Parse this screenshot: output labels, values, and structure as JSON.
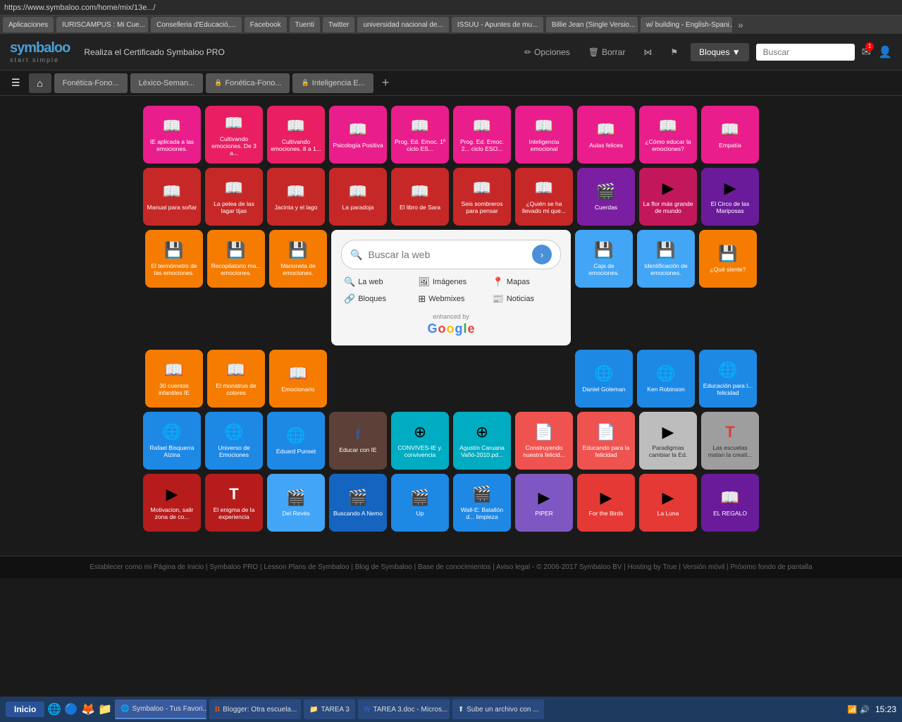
{
  "browser": {
    "url": "https://www.symbaloo.com/home/mix/13e.../",
    "tabs": [
      {
        "label": "Aplicaciones",
        "active": false
      },
      {
        "label": "IURISCAMPUS : Mi Cue...",
        "active": false
      },
      {
        "label": "Conselleria d'Educació,...",
        "active": false
      },
      {
        "label": "Facebook",
        "active": false
      },
      {
        "label": "Tuenti",
        "active": false
      },
      {
        "label": "Twitter",
        "active": false
      },
      {
        "label": "universidad nacional de...",
        "active": false
      },
      {
        "label": "ISSUU - Apuntes de mu...",
        "active": false
      },
      {
        "label": "Billie Jean (Single Versio...",
        "active": false
      },
      {
        "label": "w/ building - English-Spani...",
        "active": false
      }
    ]
  },
  "header": {
    "logo": "symbaloo",
    "logo_sub": "start simple",
    "pro_text": "Realiza el Certificado Symbaloo PRO",
    "options_label": "Opciones",
    "delete_label": "Borrar",
    "blocks_label": "Bloques ▼",
    "search_placeholder": "Buscar"
  },
  "tabs": [
    {
      "label": "Fonética-Fono...",
      "locked": false
    },
    {
      "label": "Léxico-Seman...",
      "locked": false
    },
    {
      "label": "Fonética-Fono...",
      "locked": true
    },
    {
      "label": "Inteligencia E...",
      "locked": true
    }
  ],
  "search": {
    "placeholder": "Buscar la web",
    "links": [
      {
        "icon": "🔍",
        "label": "La web"
      },
      {
        "icon": "🖼",
        "label": "Imágenes"
      },
      {
        "icon": "📍",
        "label": "Mapas"
      },
      {
        "icon": "🔗",
        "label": "Bloques"
      },
      {
        "icon": "⊞",
        "label": "Webmixes"
      },
      {
        "icon": "📰",
        "label": "Noticias"
      }
    ],
    "powered_by": "enhanced by",
    "google": "Google"
  },
  "tiles_row1": [
    {
      "label": "IE aplicada a las emociones.",
      "bg": "#e91e8c",
      "icon": "📖"
    },
    {
      "label": "Cultivando emociones. De 3 a...",
      "bg": "#e91e63",
      "icon": "📖"
    },
    {
      "label": "Cultivando emociones. 8 a 1...",
      "bg": "#e91e63",
      "icon": "📖"
    },
    {
      "label": "Psicología Positiva",
      "bg": "#e91e8c",
      "icon": "📖"
    },
    {
      "label": "Prog. Ed. Emoc. 1º ciclo ES...",
      "bg": "#e91e8c",
      "icon": "📖"
    },
    {
      "label": "Prog. Ed. Emoc. 2... ciclo ESO...",
      "bg": "#e91e8c",
      "icon": "📖"
    },
    {
      "label": "Inteligencia emocional",
      "bg": "#e91e8c",
      "icon": "📖"
    },
    {
      "label": "Aulas felices",
      "bg": "#e91e8c",
      "icon": "📖"
    },
    {
      "label": "¿Cómo educar la emociones?",
      "bg": "#e91e8c",
      "icon": "📖"
    },
    {
      "label": "Empatía",
      "bg": "#e91e8c",
      "icon": "📖"
    }
  ],
  "tiles_row2": [
    {
      "label": "Manual para soñar",
      "bg": "#e53935",
      "icon": "📖"
    },
    {
      "label": "La pelea de las lagar tijas",
      "bg": "#e53935",
      "icon": "📖"
    },
    {
      "label": "Jacinta y el lago",
      "bg": "#e53935",
      "icon": "📖"
    },
    {
      "label": "La paradoja",
      "bg": "#e53935",
      "icon": "📖"
    },
    {
      "label": "El libro de Sara",
      "bg": "#e53935",
      "icon": "📖"
    },
    {
      "label": "Seis sombreros para pensar",
      "bg": "#e53935",
      "icon": "📖"
    },
    {
      "label": "¿Quién se ha llevado mi que...",
      "bg": "#e53935",
      "icon": "📖"
    },
    {
      "label": "Cuerdas",
      "bg": "#9c27b0",
      "icon": "🎬"
    },
    {
      "label": "La flor más grande de mundo",
      "bg": "#c2185b",
      "icon": "▶"
    },
    {
      "label": "El Circo de las Mariposas",
      "bg": "#7b1fa2",
      "icon": "▶"
    }
  ],
  "tiles_row3_left": [
    {
      "label": "El termómetro de las emociones.",
      "bg": "#f57c00",
      "icon": "💾"
    },
    {
      "label": "Recopilatorio ma... emociones.",
      "bg": "#f57c00",
      "icon": "💾"
    },
    {
      "label": "Marioneta de emociones.",
      "bg": "#f57c00",
      "icon": "💾"
    }
  ],
  "tiles_row3_right": [
    {
      "label": "Caja de emociones.",
      "bg": "#42a5f5",
      "icon": "💾"
    },
    {
      "label": "Identificación de emociones.",
      "bg": "#42a5f5",
      "icon": "💾"
    },
    {
      "label": "¿Qué siente?",
      "bg": "#f57c00",
      "icon": "💾"
    }
  ],
  "tiles_row4": [
    {
      "label": "30 cuentos infantiles IE",
      "bg": "#f57c00",
      "icon": "📖"
    },
    {
      "label": "El monstruo de colores",
      "bg": "#f57c00",
      "icon": "📖"
    },
    {
      "label": "Emocionario",
      "bg": "#f57c00",
      "icon": "📖"
    },
    {
      "label": "Daniel Goleman",
      "bg": "#1e88e5",
      "icon": "🌐"
    },
    {
      "label": "Ken Robinson",
      "bg": "#1e88e5",
      "icon": "🌐"
    },
    {
      "label": "Educación para l... felicidad",
      "bg": "#1e88e5",
      "icon": "🌐"
    }
  ],
  "tiles_row5": [
    {
      "label": "Rafael Bisquerra Alzina",
      "bg": "#1e88e5",
      "icon": "🌐"
    },
    {
      "label": "Universo de Emociones",
      "bg": "#1e88e5",
      "icon": "🌐"
    },
    {
      "label": "Eduard Punset",
      "bg": "#1e88e5",
      "icon": "🌐"
    },
    {
      "label": "Educar con IE",
      "bg": "#795548",
      "icon": "f"
    },
    {
      "label": "CONVIVES-IE y. convivencia",
      "bg": "#00acc1",
      "icon": "⊕"
    },
    {
      "label": "Agustín Caruana Vañó-2010.pd...",
      "bg": "#00acc1",
      "icon": "⊕"
    },
    {
      "label": "Construyendo nuestra felicid...",
      "bg": "#ef5350",
      "icon": "📄"
    },
    {
      "label": "Educando para la felicidad",
      "bg": "#ef5350",
      "icon": "📄"
    },
    {
      "label": "Paradigmas cambiar la Ed.",
      "bg": "#bdbdbd",
      "icon": "▶"
    },
    {
      "label": "Las escuelas matan la creati...",
      "bg": "#9e9e9e",
      "icon": "T"
    }
  ],
  "tiles_row6": [
    {
      "label": "Motivacion, salir zona de co...",
      "bg": "#b71c1c",
      "icon": "▶"
    },
    {
      "label": "El enigma de la experiencia",
      "bg": "#b71c1c",
      "icon": "T"
    },
    {
      "label": "Del Revés",
      "bg": "#42a5f5",
      "icon": "🎬"
    },
    {
      "label": "Buscando A Nemo",
      "bg": "#1565c0",
      "icon": "🎬"
    },
    {
      "label": "Up",
      "bg": "#1e88e5",
      "icon": "🎬"
    },
    {
      "label": "Wall-E: Batallón d... limpieza",
      "bg": "#1e88e5",
      "icon": "🎬"
    },
    {
      "label": "PIPER",
      "bg": "#7e57c2",
      "icon": "▶"
    },
    {
      "label": "For the Birds",
      "bg": "#e53935",
      "icon": "▶"
    },
    {
      "label": "La Luna",
      "bg": "#e53935",
      "icon": "▶"
    },
    {
      "label": "EL REGALO",
      "bg": "#7b1fa2",
      "icon": "📖"
    }
  ],
  "footer": {
    "links": [
      "Establecer como mi Página de Inicio",
      "Symbaloo PRO",
      "Lesson Plans de Symbaloo",
      "Blog de Symbaloo",
      "Base de conocimientos",
      "Aviso legal",
      "© 2006-2017 Symbaloo BV",
      "Hosting by True",
      "Versión móvil",
      "Próximo fondo de pantalla"
    ]
  },
  "taskbar": {
    "start_label": "Inicio",
    "tasks": [
      {
        "label": "Symbaloo - Tus Favori...",
        "icon": "🌐",
        "active": true
      },
      {
        "label": "Blogger: Otra escuela...",
        "icon": "B",
        "active": false
      },
      {
        "label": "TAREA 3",
        "icon": "📁",
        "active": false
      },
      {
        "label": "TAREA 3.doc - Micros...",
        "icon": "W",
        "active": false
      },
      {
        "label": "Sube un archivo con ...",
        "icon": "⬆",
        "active": false
      }
    ],
    "time": "15:23"
  }
}
